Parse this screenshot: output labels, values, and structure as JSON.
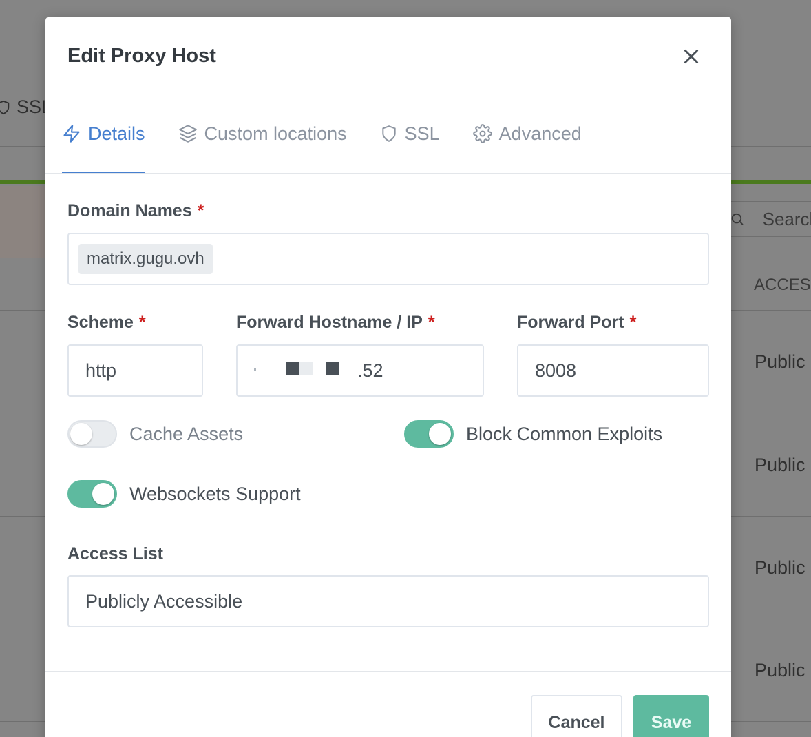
{
  "background": {
    "tab_label": "SSL",
    "search_placeholder": "Search",
    "column_header": "ACCESS",
    "row_values": [
      "Public",
      "Public",
      "Public",
      "Public"
    ]
  },
  "modal": {
    "title": "Edit Proxy Host",
    "tabs": [
      {
        "label": "Details",
        "icon": "zap-icon",
        "active": true
      },
      {
        "label": "Custom locations",
        "icon": "layers-icon",
        "active": false
      },
      {
        "label": "SSL",
        "icon": "shield-icon",
        "active": false
      },
      {
        "label": "Advanced",
        "icon": "gear-icon",
        "active": false
      }
    ],
    "domain_names": {
      "label": "Domain Names",
      "required": "*",
      "tags": [
        "matrix.gugu.ovh"
      ]
    },
    "scheme": {
      "label": "Scheme",
      "required": "*",
      "value": "http"
    },
    "forward_host": {
      "label": "Forward Hostname / IP",
      "required": "*",
      "value_suffix": ".52"
    },
    "forward_port": {
      "label": "Forward Port",
      "required": "*",
      "value": "8008"
    },
    "toggles": {
      "cache_assets": {
        "label": "Cache Assets",
        "on": false
      },
      "block_exploits": {
        "label": "Block Common Exploits",
        "on": true
      },
      "websockets": {
        "label": "Websockets Support",
        "on": true
      }
    },
    "access_list": {
      "label": "Access List",
      "value": "Publicly Accessible"
    },
    "buttons": {
      "cancel": "Cancel",
      "save": "Save"
    }
  },
  "colors": {
    "accent": "#467fcf",
    "toggle_on": "#5eba9f",
    "required": "#cd201f",
    "overlay": "#858585"
  }
}
